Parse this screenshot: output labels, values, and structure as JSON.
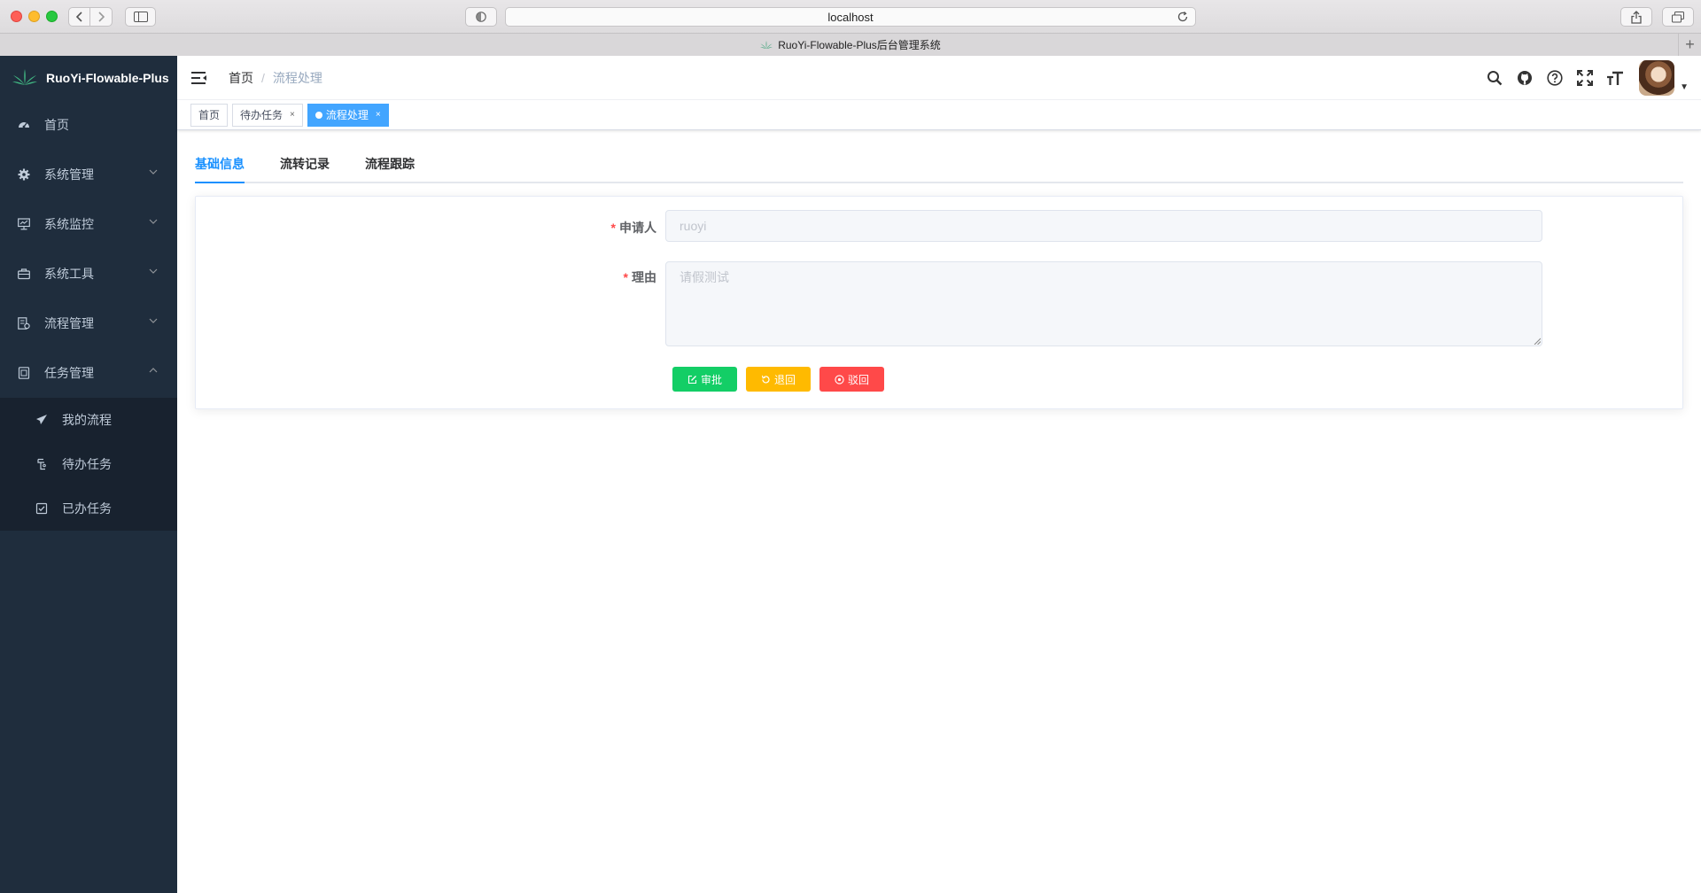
{
  "browser": {
    "url": "localhost",
    "tab_title": "RuoYi-Flowable-Plus后台管理系统"
  },
  "sidebar": {
    "brand": "RuoYi-Flowable-Plus",
    "items": [
      {
        "label": "首页",
        "icon": "dashboard-icon"
      },
      {
        "label": "系统管理",
        "icon": "gear-icon"
      },
      {
        "label": "系统监控",
        "icon": "monitor-icon"
      },
      {
        "label": "系统工具",
        "icon": "toolbox-icon"
      },
      {
        "label": "流程管理",
        "icon": "process-icon"
      },
      {
        "label": "任务管理",
        "icon": "task-icon"
      }
    ],
    "sub_items": [
      {
        "label": "我的流程",
        "icon": "send-icon"
      },
      {
        "label": "待办任务",
        "icon": "todo-icon"
      },
      {
        "label": "已办任务",
        "icon": "checkbox-icon"
      }
    ]
  },
  "breadcrumb": {
    "home": "首页",
    "separator": "/",
    "current": "流程处理"
  },
  "tags": [
    {
      "label": "首页"
    },
    {
      "label": "待办任务",
      "close": "×"
    },
    {
      "label": "流程处理",
      "close": "×"
    }
  ],
  "tabs": [
    "基础信息",
    "流转记录",
    "流程跟踪"
  ],
  "form": {
    "applicant_label": "申请人",
    "applicant_value": "ruoyi",
    "reason_label": "理由",
    "reason_value": "请假测试",
    "required_mark": "*"
  },
  "buttons": {
    "approve": "审批",
    "return": "退回",
    "reject": "驳回"
  },
  "colors": {
    "sidebar_bg": "#1f2d3d",
    "accent": "#1890ff",
    "approve": "#13ce66",
    "return": "#ffba00",
    "reject": "#ff4949"
  }
}
